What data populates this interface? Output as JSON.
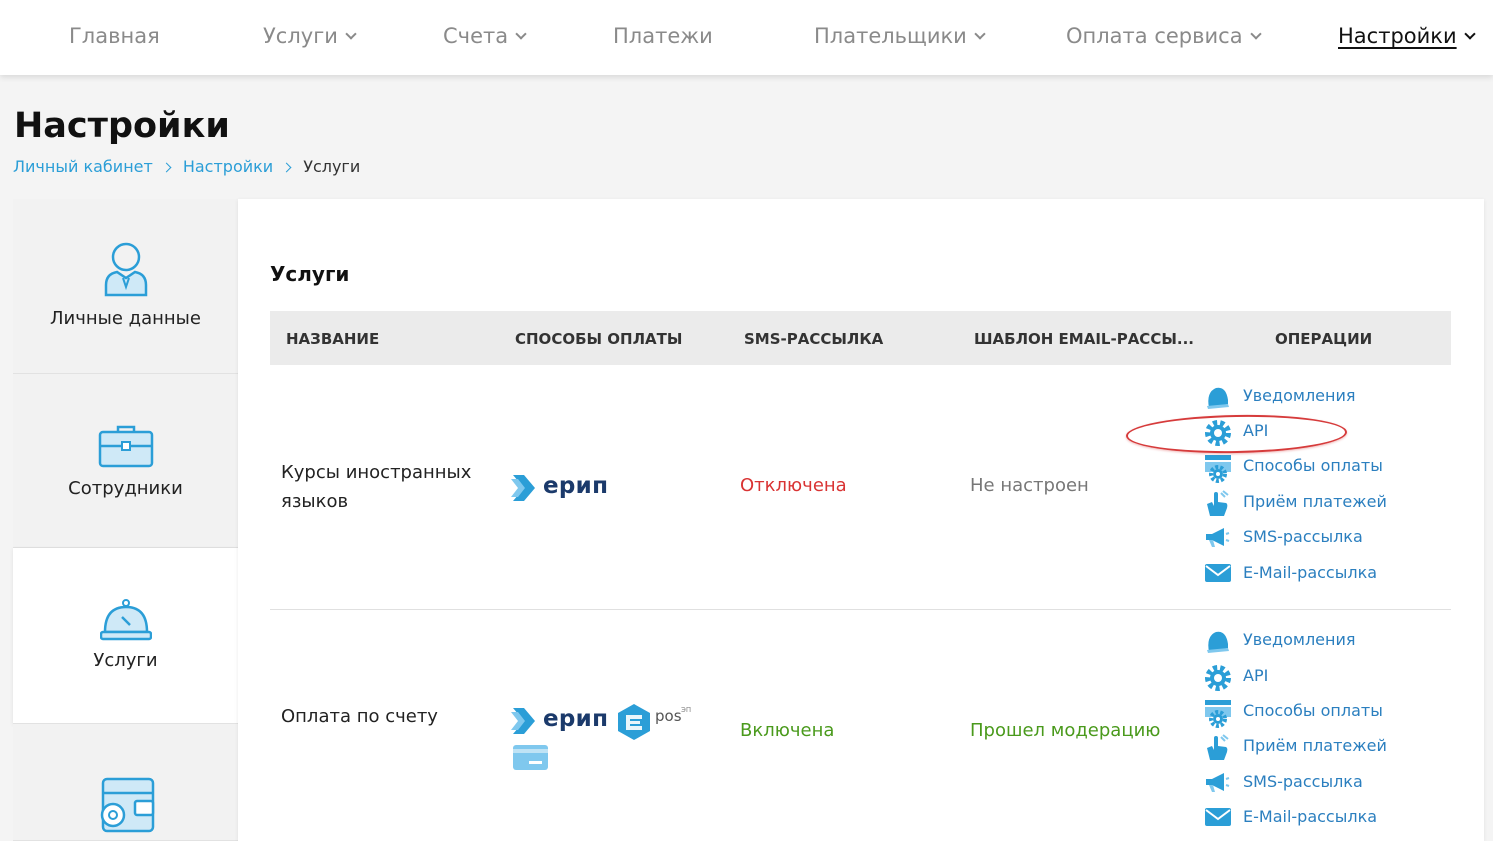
{
  "nav": {
    "items": [
      {
        "label": "Главная",
        "dropdown": false
      },
      {
        "label": "Услуги",
        "dropdown": true
      },
      {
        "label": "Счета",
        "dropdown": true
      },
      {
        "label": "Платежи",
        "dropdown": false
      },
      {
        "label": "Плательщики",
        "dropdown": true
      },
      {
        "label": "Оплата сервиса",
        "dropdown": true
      },
      {
        "label": "Настройки",
        "dropdown": true,
        "active": true
      }
    ]
  },
  "page": {
    "title": "Настройки",
    "breadcrumb": [
      "Личный кабинет",
      "Настройки",
      "Услуги"
    ]
  },
  "sidebar": {
    "tabs": [
      {
        "label": "Личные данные",
        "icon": "user-icon",
        "active": false
      },
      {
        "label": "Сотрудники",
        "icon": "briefcase-icon",
        "active": false
      },
      {
        "label": "Услуги",
        "icon": "service-bell-icon",
        "active": true
      },
      {
        "label": "",
        "icon": "wallet-gear-icon",
        "active": false
      }
    ]
  },
  "services": {
    "title": "Услуги",
    "columns": [
      "НАЗВАНИЕ",
      "СПОСОБЫ ОПЛАТЫ",
      "SMS-РАССЫЛКА",
      "ШАБЛОН EMAIL-РАССЫ...",
      "ОПЕРАЦИИ"
    ],
    "rows": [
      {
        "name": "Курсы иностранных языков",
        "payment_methods": [
          "erip-logo"
        ],
        "sms": "Отключена",
        "email_template": "Не настроен"
      },
      {
        "name": "Оплата по счету",
        "payment_methods": [
          "erip-logo",
          "epos-logo",
          "card-icon"
        ],
        "sms": "Включена",
        "email_template": "Прошел модерацию"
      }
    ],
    "operations": [
      "Уведомления",
      "API",
      "Способы оплаты",
      "Приём платежей",
      "SMS-рассылка",
      "E-Mail-рассылка"
    ]
  },
  "logos": {
    "erip": "ерип",
    "epos": "pos",
    "epos_sup": "ЭП"
  },
  "colors": {
    "accent": "#2b9ed7",
    "link": "#2b7fbf",
    "danger": "#d93333",
    "success": "#4a9a1c",
    "highlight": "#d63b3b"
  }
}
